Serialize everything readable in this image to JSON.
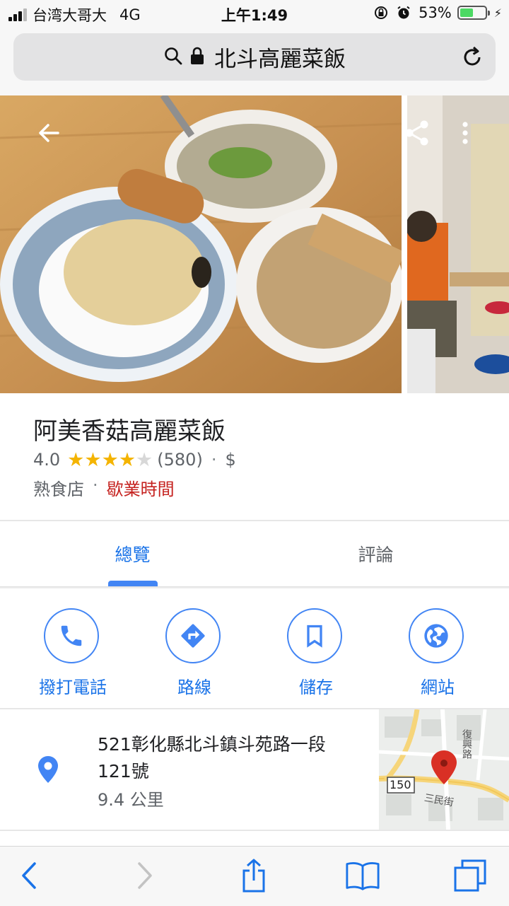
{
  "status_bar": {
    "carrier": "台湾大哥大",
    "network": "4G",
    "time": "上午1:49",
    "battery": "53%",
    "battery_level": 0.53
  },
  "browser": {
    "url_text": "北斗高麗菜飯",
    "icons": [
      "search-icon",
      "lock-icon",
      "reload-icon"
    ]
  },
  "place": {
    "name": "阿美香菇高麗菜飯",
    "rating": "4.0",
    "rating_value": 4,
    "review_count": "(580)",
    "price": "$",
    "separator": "·",
    "category": "熟食店",
    "hours_label": "歇業時間"
  },
  "tabs": [
    {
      "label": "總覽",
      "selected": true
    },
    {
      "label": "評論",
      "selected": false
    }
  ],
  "actions": [
    {
      "label": "撥打電話",
      "icon": "phone-icon"
    },
    {
      "label": "路線",
      "icon": "directions-icon"
    },
    {
      "label": "儲存",
      "icon": "bookmark-icon"
    },
    {
      "label": "網站",
      "icon": "globe-icon"
    }
  ],
  "address": {
    "line1": "521彰化縣北斗鎮斗苑路一段",
    "line2": "121號",
    "distance": "9.4 公里"
  },
  "map": {
    "road_number": "150",
    "street_1": "復興路",
    "street_2": "三民街"
  },
  "colors": {
    "accent": "#1a73e8",
    "star": "#f4b400",
    "hours": "#c5221f",
    "pin": "#d93025",
    "battery": "#4cd964"
  }
}
